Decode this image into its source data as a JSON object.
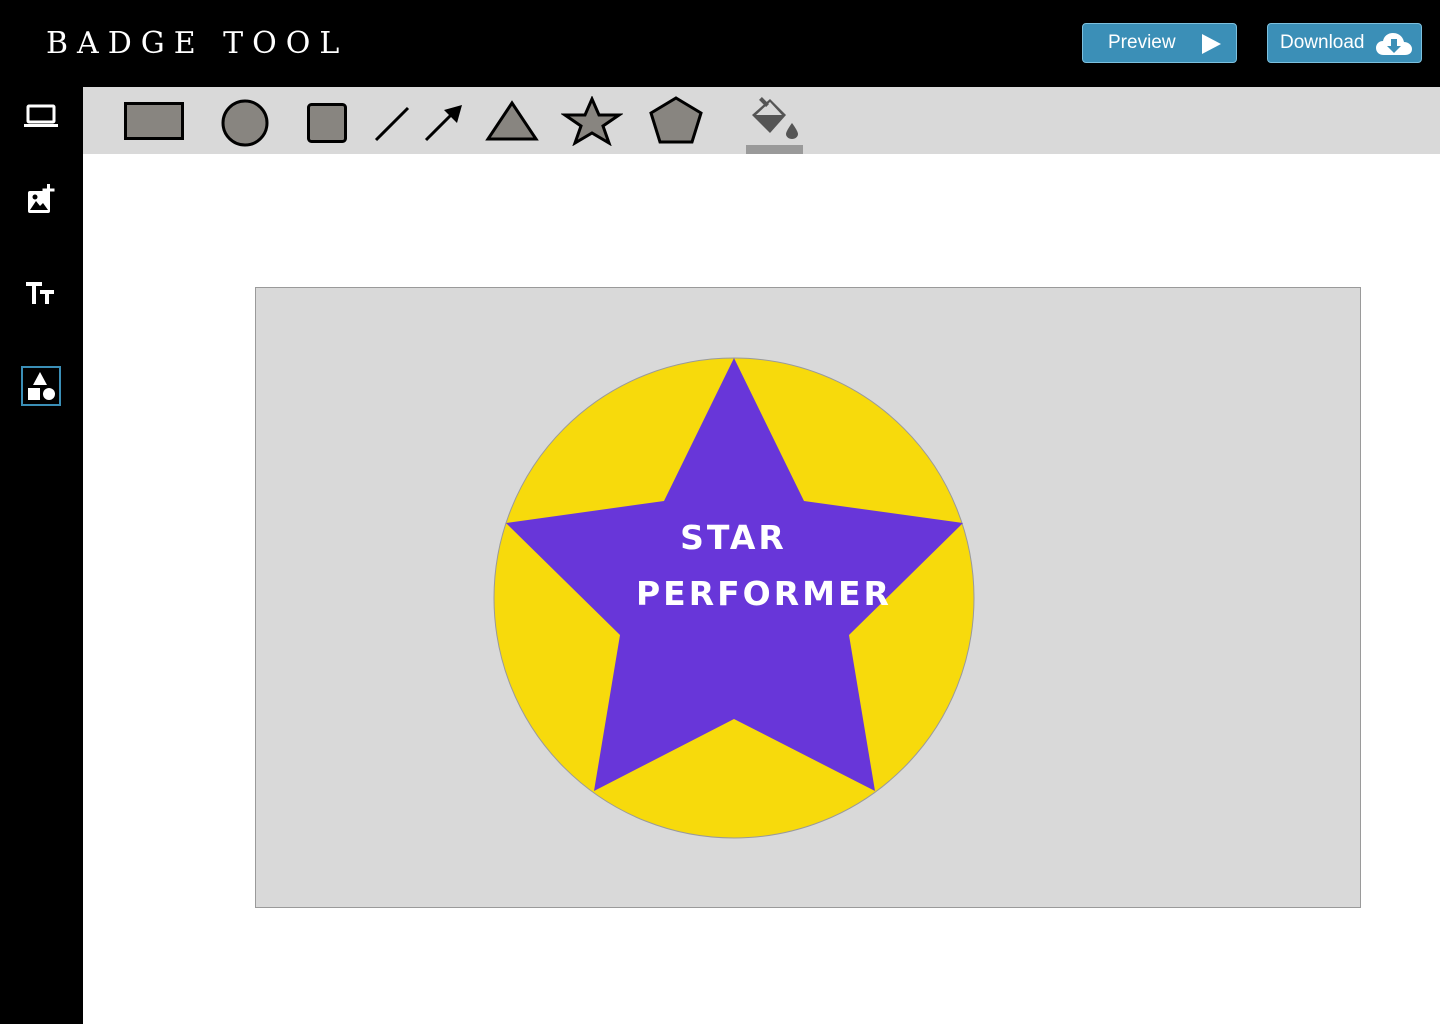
{
  "app": {
    "title": "BADGE TOOL"
  },
  "header": {
    "preview_label": "Preview",
    "download_label": "Download",
    "button_color": "#3b8fb7"
  },
  "sidebar": {
    "items": [
      {
        "name": "laptop-icon",
        "active": false
      },
      {
        "name": "add-image-icon",
        "active": false
      },
      {
        "name": "text-size-icon",
        "active": false
      },
      {
        "name": "shapes-icon",
        "active": true
      }
    ]
  },
  "toolbar": {
    "tools": [
      "rectangle",
      "circle",
      "square",
      "line",
      "arrow",
      "triangle",
      "star",
      "pentagon",
      "fill-color"
    ],
    "shape_fill": "#888580"
  },
  "badge": {
    "line1": "STAR",
    "line2": "PERFORMER",
    "circle_color": "#f7da0c",
    "star_color": "#6836d9",
    "background_color": "#d9d9d9",
    "text_color": "#ffffff"
  }
}
